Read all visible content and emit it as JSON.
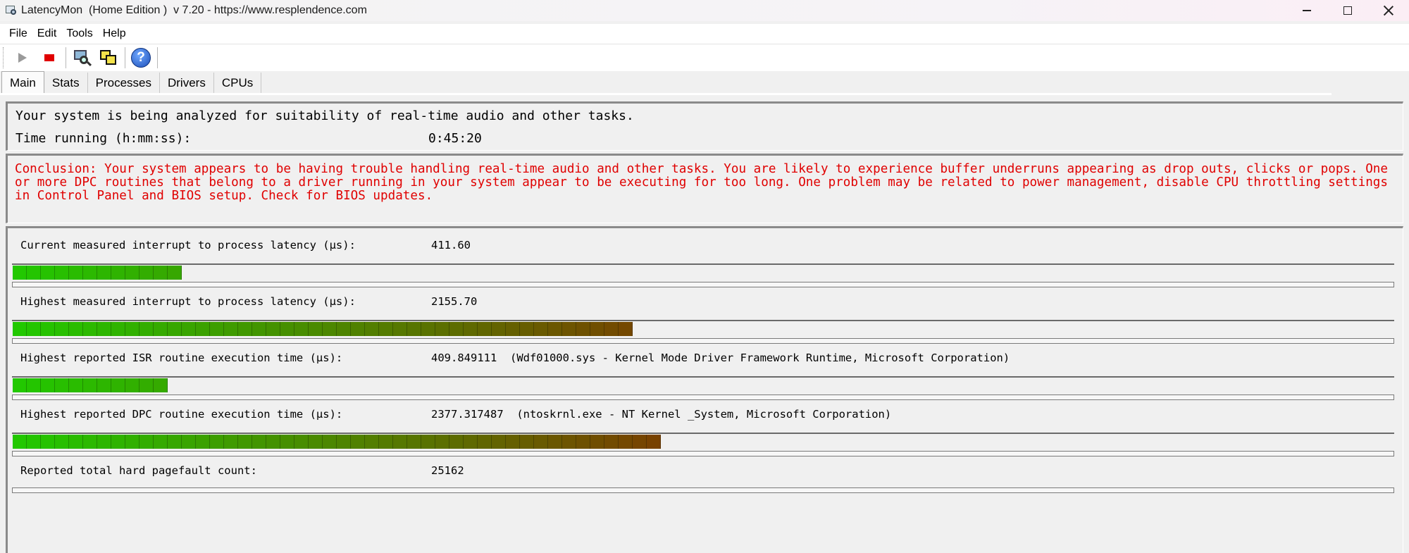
{
  "window": {
    "title": "LatencyMon  (Home Edition )  v 7.20 - https://www.resplendence.com",
    "minimize_icon": "minimize-icon",
    "maximize_icon": "maximize-icon",
    "close_icon": "close-icon"
  },
  "menu": [
    "File",
    "Edit",
    "Tools",
    "Help"
  ],
  "toolbar": {
    "buttons": [
      {
        "name": "start-button",
        "icon": "play-icon"
      },
      {
        "name": "stop-button",
        "icon": "stop-icon"
      },
      {
        "name": "monitor-button",
        "icon": "monitor-magnifier-icon"
      },
      {
        "name": "windows-button",
        "icon": "cascade-windows-icon"
      },
      {
        "name": "help-button",
        "icon": "help-icon",
        "glyph": "?"
      }
    ]
  },
  "tabs": [
    {
      "label": "Main",
      "active": true
    },
    {
      "label": "Stats",
      "active": false
    },
    {
      "label": "Processes",
      "active": false
    },
    {
      "label": "Drivers",
      "active": false
    },
    {
      "label": "CPUs",
      "active": false
    }
  ],
  "status": {
    "analysis_text": "Your system is being analyzed for suitability of real-time audio and other tasks.",
    "time_label": "Time running (h:mm:ss):",
    "time_value": "0:45:20"
  },
  "conclusion": "Conclusion: Your system appears to be having trouble handling real-time audio and other tasks. You are likely to experience buffer underruns appearing as drop outs, clicks or pops. One or more DPC routines that belong to a driver running in your system appear to be executing for too long. One problem may be related to power management, disable CPU throttling settings in Control Panel and BIOS setup. Check for BIOS updates.",
  "metrics": [
    {
      "label": "Current measured interrupt to process latency (µs):",
      "value": "411.60",
      "bar_blocks": 12,
      "bar_total_blocks": 98
    },
    {
      "label": "Highest measured interrupt to process latency (µs):",
      "value": "2155.70",
      "bar_blocks": 44,
      "bar_total_blocks": 98
    },
    {
      "label": "Highest reported ISR routine execution time (µs):",
      "value": "409.849111  (Wdf01000.sys - Kernel Mode Driver Framework Runtime, Microsoft Corporation)",
      "bar_blocks": 11,
      "bar_total_blocks": 98
    },
    {
      "label": "Highest reported DPC routine execution time (µs):",
      "value": "2377.317487  (ntoskrnl.exe - NT Kernel _System, Microsoft Corporation)",
      "bar_blocks": 46,
      "bar_total_blocks": 98
    },
    {
      "label": "Reported total hard pagefault count:",
      "value": "25162",
      "bar_blocks": 0,
      "bar_total_blocks": 98
    }
  ],
  "colors": {
    "conclusion_text": "#e00000",
    "bar_green": "#22c800",
    "bar_brown": "#7a3f00"
  }
}
